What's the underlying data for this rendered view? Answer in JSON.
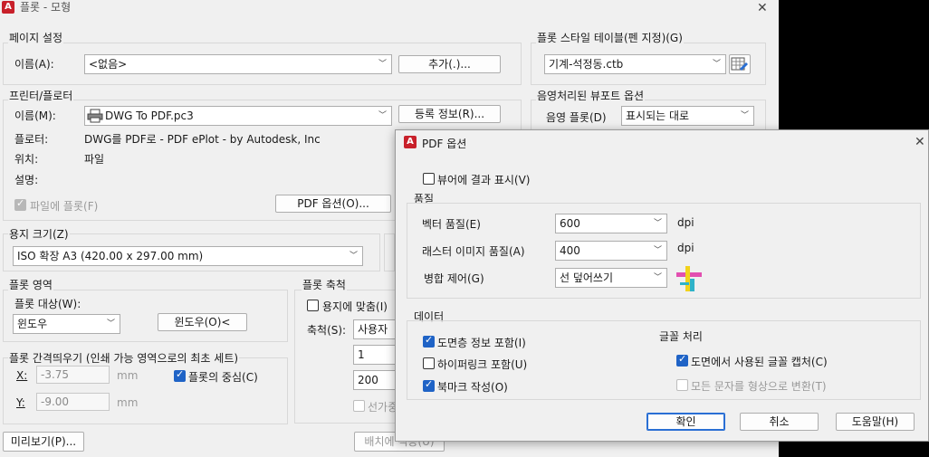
{
  "main": {
    "title": "플롯 - 모형",
    "page_setup": {
      "section": "페이지 설정",
      "name_label": "이름(A):",
      "name_value": "<없음>",
      "add_button": "추가(.)..."
    },
    "printer": {
      "section": "프린터/플로터",
      "name_label": "이름(M):",
      "name_value": "DWG To PDF.pc3",
      "properties_button": "등록 정보(R)...",
      "plotter_label": "플로터:",
      "plotter_value": "DWG를 PDF로 - PDF ePlot - by Autodesk, Inc",
      "where_label": "위치:",
      "where_value": "파일",
      "desc_label": "설명:",
      "plot_to_file": "파일에 플롯(F)",
      "pdf_options_button": "PDF 옵션(O)..."
    },
    "paper_size": {
      "section": "용지 크기(Z)",
      "value": "ISO 확장 A3 (420.00 x 297.00 mm)"
    },
    "plot_area": {
      "section": "플롯 영역",
      "what_label": "플롯 대상(W):",
      "what_value": "윈도우",
      "window_button": "윈도우(O)<"
    },
    "plot_offset": {
      "section": "플롯 간격띄우기 (인쇄 가능 영역으로의 최초 세트)",
      "x_label": "X:",
      "x_value": "-3.75",
      "x_unit": "mm",
      "y_label": "Y:",
      "y_value": "-9.00",
      "y_unit": "mm",
      "center": "플롯의 중심(C)"
    },
    "plot_scale": {
      "section": "플롯 축척",
      "fit": "용지에 맞춤(I)",
      "scale_label": "축척(S):",
      "scale_value": "사용자",
      "v1": "1",
      "v2": "200",
      "lineweights": "선가중"
    },
    "style_table": {
      "section": "플롯 스타일 테이블(펜 지정)(G)",
      "value": "기계-석정동.ctb"
    },
    "shaded": {
      "section": "음영처리된 뷰포트 옵션",
      "shade_label": "음영 플롯(D)",
      "shade_value": "표시되는 대로"
    },
    "preview_button": "미리보기(P)...",
    "apply_button": "배치에 적용(U)"
  },
  "dialog": {
    "title": "PDF 옵션",
    "view_result": "뷰어에 결과 표시(V)",
    "quality": {
      "section": "품질",
      "vector_label": "벡터 품질(E)",
      "vector_value": "600",
      "vector_unit": "dpi",
      "raster_label": "래스터 이미지 품질(A)",
      "raster_value": "400",
      "raster_unit": "dpi",
      "merge_label": "병합 제어(G)",
      "merge_value": "선 덮어쓰기"
    },
    "data": {
      "section": "데이터",
      "layer_info": "도면층 정보 포함(I)",
      "hyperlinks": "하이퍼링크 포함(U)",
      "bookmarks": "북마크 작성(O)"
    },
    "fonts": {
      "section": "글꼴 처리",
      "capture": "도면에서 사용된 글꼴 캡처(C)",
      "convert": "모든 문자를 형상으로 변환(T)"
    },
    "ok": "확인",
    "cancel": "취소",
    "help": "도움말(H)"
  },
  "colors": {
    "accent": "#1f63c6",
    "app_icon": "#c8202a"
  }
}
